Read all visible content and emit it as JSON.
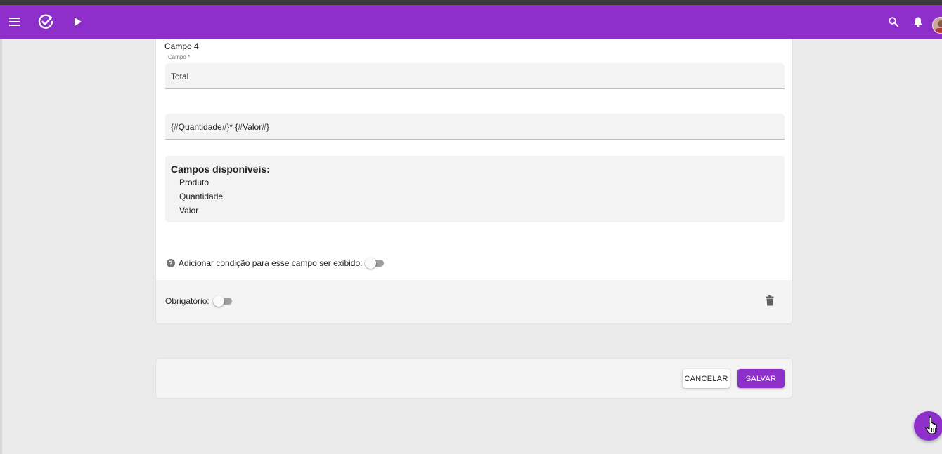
{
  "appbar": {
    "color": "#8e2fcb",
    "icons": [
      "menu-icon",
      "check-circle-icon",
      "play-icon",
      "search-icon",
      "bell-icon",
      "avatar"
    ]
  },
  "field_card": {
    "title": "Campo 4",
    "campo_label": "Campo *",
    "campo_value": "Total",
    "formula_value": "{#Quantidade#}* {#Valor#}",
    "available_title": "Campos disponíveis:",
    "available_fields": [
      "Produto",
      "Quantidade",
      "Valor"
    ],
    "condition_label": "Adicionar condição para esse campo ser exibido:",
    "condition_toggle_on": false,
    "required_label": "Obrigatório:",
    "required_toggle_on": false
  },
  "actions": {
    "cancel_label": "CANCELAR",
    "save_label": "SALVAR"
  }
}
